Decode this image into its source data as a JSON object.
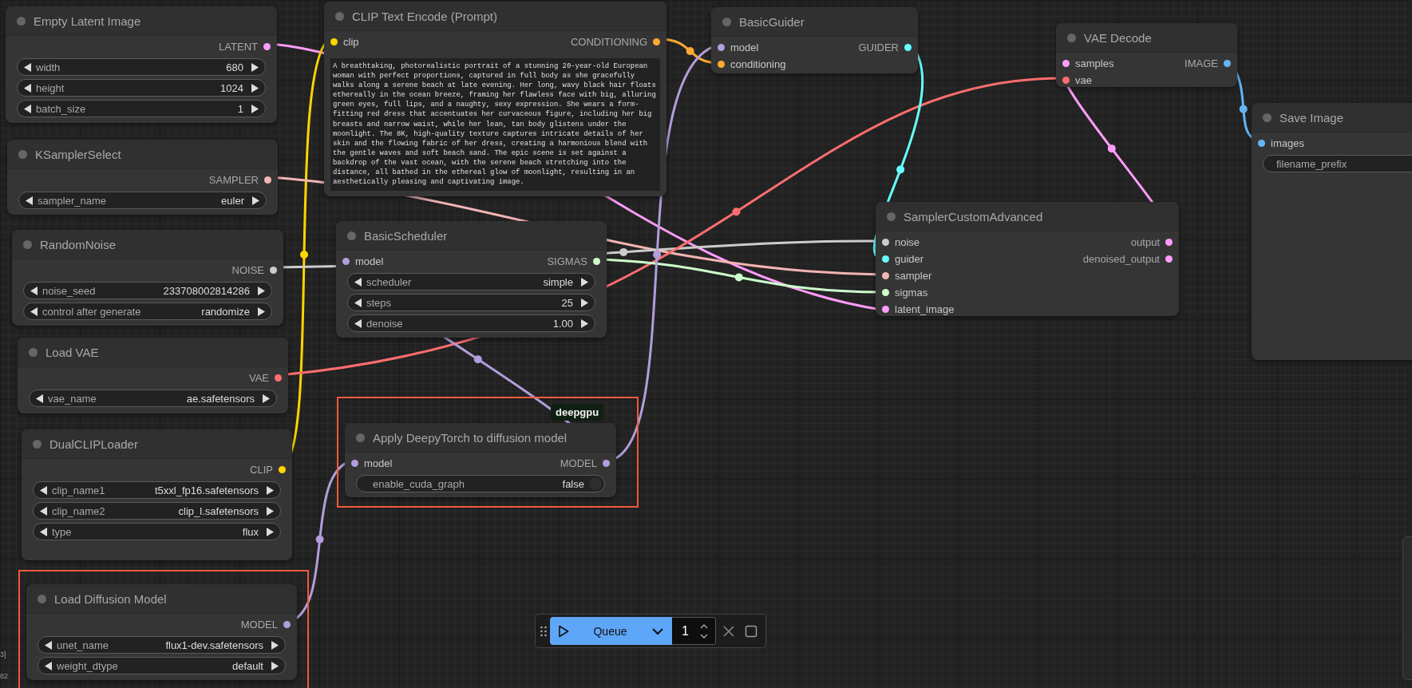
{
  "nodes": [
    {
      "title": "Empty Latent Image",
      "highlighted": false,
      "outputs": [
        {
          "label": "LATENT",
          "color": "#ff9cf9"
        }
      ],
      "widgets": [
        {
          "kind": "combo",
          "label": "width",
          "value": "680"
        },
        {
          "kind": "combo",
          "label": "height",
          "value": "1024"
        },
        {
          "kind": "combo",
          "label": "batch_size",
          "value": "1"
        }
      ]
    },
    {
      "title": "KSamplerSelect",
      "highlighted": false,
      "outputs": [
        {
          "label": "SAMPLER",
          "color": "#f4b4b4"
        }
      ],
      "widgets": [
        {
          "kind": "combo",
          "label": "sampler_name",
          "value": "euler"
        }
      ]
    },
    {
      "title": "RandomNoise",
      "highlighted": false,
      "outputs": [
        {
          "label": "NOISE",
          "color": "#cccccc"
        }
      ],
      "widgets": [
        {
          "kind": "combo",
          "label": "noise_seed",
          "value": "233708002814286"
        },
        {
          "kind": "combo",
          "label": "control after generate",
          "value": "randomize"
        }
      ]
    },
    {
      "title": "Load VAE",
      "highlighted": false,
      "outputs": [
        {
          "label": "VAE",
          "color": "#ff6e6e"
        }
      ],
      "widgets": [
        {
          "kind": "combo",
          "label": "vae_name",
          "value": "ae.safetensors"
        }
      ]
    },
    {
      "title": "DualCLIPLoader",
      "highlighted": false,
      "outputs": [
        {
          "label": "CLIP",
          "color": "#ffd500"
        }
      ],
      "widgets": [
        {
          "kind": "combo",
          "label": "clip_name1",
          "value": "t5xxl_fp16.safetensors"
        },
        {
          "kind": "combo",
          "label": "clip_name2",
          "value": "clip_l.safetensors"
        },
        {
          "kind": "combo",
          "label": "type",
          "value": "flux"
        }
      ]
    },
    {
      "title": "Load Diffusion Model",
      "highlighted": true,
      "outputs": [
        {
          "label": "MODEL",
          "color": "#b39ddb"
        }
      ],
      "widgets": [
        {
          "kind": "combo",
          "label": "unet_name",
          "value": "flux1-dev.safetensors"
        },
        {
          "kind": "combo",
          "label": "weight_dtype",
          "value": "default"
        }
      ]
    },
    {
      "title": "CLIP Text Encode (Prompt)",
      "highlighted": false,
      "inputs": [
        {
          "label": "clip",
          "color": "#ffd500"
        }
      ],
      "outputs": [
        {
          "label": "CONDITIONING",
          "color": "#ffa931"
        }
      ],
      "widgets": [
        {
          "kind": "textarea",
          "value": "A breathtaking, photorealistic portrait of a stunning 20-year-old European woman with perfect proportions, captured in full body as she gracefully walks along a serene beach at late evening. Her long, wavy black hair floats ethereally in the ocean breeze, framing her flawless face with big, alluring green eyes, full lips, and a naughty, sexy expression. She wears a form-fitting red dress that accentuates her curvaceous figure, including her big breasts and narrow waist, while her lean, tan body glistens under the moonlight. The 8K, high-quality texture captures intricate details of her skin and the flowing fabric of her dress, creating a harmonious blend with the gentle waves and soft beach sand. The epic scene is set against a backdrop of the vast ocean, with the serene beach stretching into the distance, all bathed in the ethereal glow of moonlight, resulting in an aesthetically pleasing and captivating image."
        }
      ]
    },
    {
      "title": "BasicScheduler",
      "highlighted": false,
      "inputs": [
        {
          "label": "model",
          "color": "#b39ddb"
        }
      ],
      "outputs": [
        {
          "label": "SIGMAS",
          "color": "#cdffcd"
        }
      ],
      "widgets": [
        {
          "kind": "combo",
          "label": "scheduler",
          "value": "simple"
        },
        {
          "kind": "combo",
          "label": "steps",
          "value": "25"
        },
        {
          "kind": "combo",
          "label": "denoise",
          "value": "1.00"
        }
      ]
    },
    {
      "title": "Apply DeepyTorch to diffusion model",
      "highlighted": true,
      "badge": "deepgpu",
      "inputs": [
        {
          "label": "model",
          "color": "#b39ddb"
        }
      ],
      "outputs": [
        {
          "label": "MODEL",
          "color": "#b39ddb"
        }
      ],
      "widgets": [
        {
          "kind": "toggle",
          "label": "enable_cuda_graph",
          "value": "false",
          "on": false
        }
      ]
    },
    {
      "title": "BasicGuider",
      "highlighted": false,
      "inputs": [
        {
          "label": "model",
          "color": "#b39ddb"
        },
        {
          "label": "conditioning",
          "color": "#ffa931"
        }
      ],
      "outputs": [
        {
          "label": "GUIDER",
          "color": "#66ffff"
        }
      ]
    },
    {
      "title": "VAE Decode",
      "highlighted": false,
      "inputs": [
        {
          "label": "samples",
          "color": "#ff9cf9"
        },
        {
          "label": "vae",
          "color": "#ff6e6e"
        }
      ],
      "outputs": [
        {
          "label": "IMAGE",
          "color": "#64b5f6"
        }
      ]
    },
    {
      "title": "SamplerCustomAdvanced",
      "highlighted": false,
      "inputs": [
        {
          "label": "noise",
          "color": "#cccccc"
        },
        {
          "label": "guider",
          "color": "#66ffff"
        },
        {
          "label": "sampler",
          "color": "#f4b4b4"
        },
        {
          "label": "sigmas",
          "color": "#cdffcd"
        },
        {
          "label": "latent_image",
          "color": "#ff9cf9"
        }
      ],
      "outputs": [
        {
          "label": "output",
          "color": "#ff9cf9"
        },
        {
          "label": "denoised_output",
          "color": "#ff9cf9"
        }
      ]
    },
    {
      "title": "Save Image",
      "highlighted": false,
      "inputs": [
        {
          "label": "images",
          "color": "#64b5f6"
        }
      ],
      "widgets": [
        {
          "kind": "text",
          "label": "filename_prefix"
        }
      ]
    }
  ],
  "edge_texts": [
    "3]",
    "82"
  ],
  "queue_bar": {
    "button": "Queue",
    "count": "1"
  }
}
